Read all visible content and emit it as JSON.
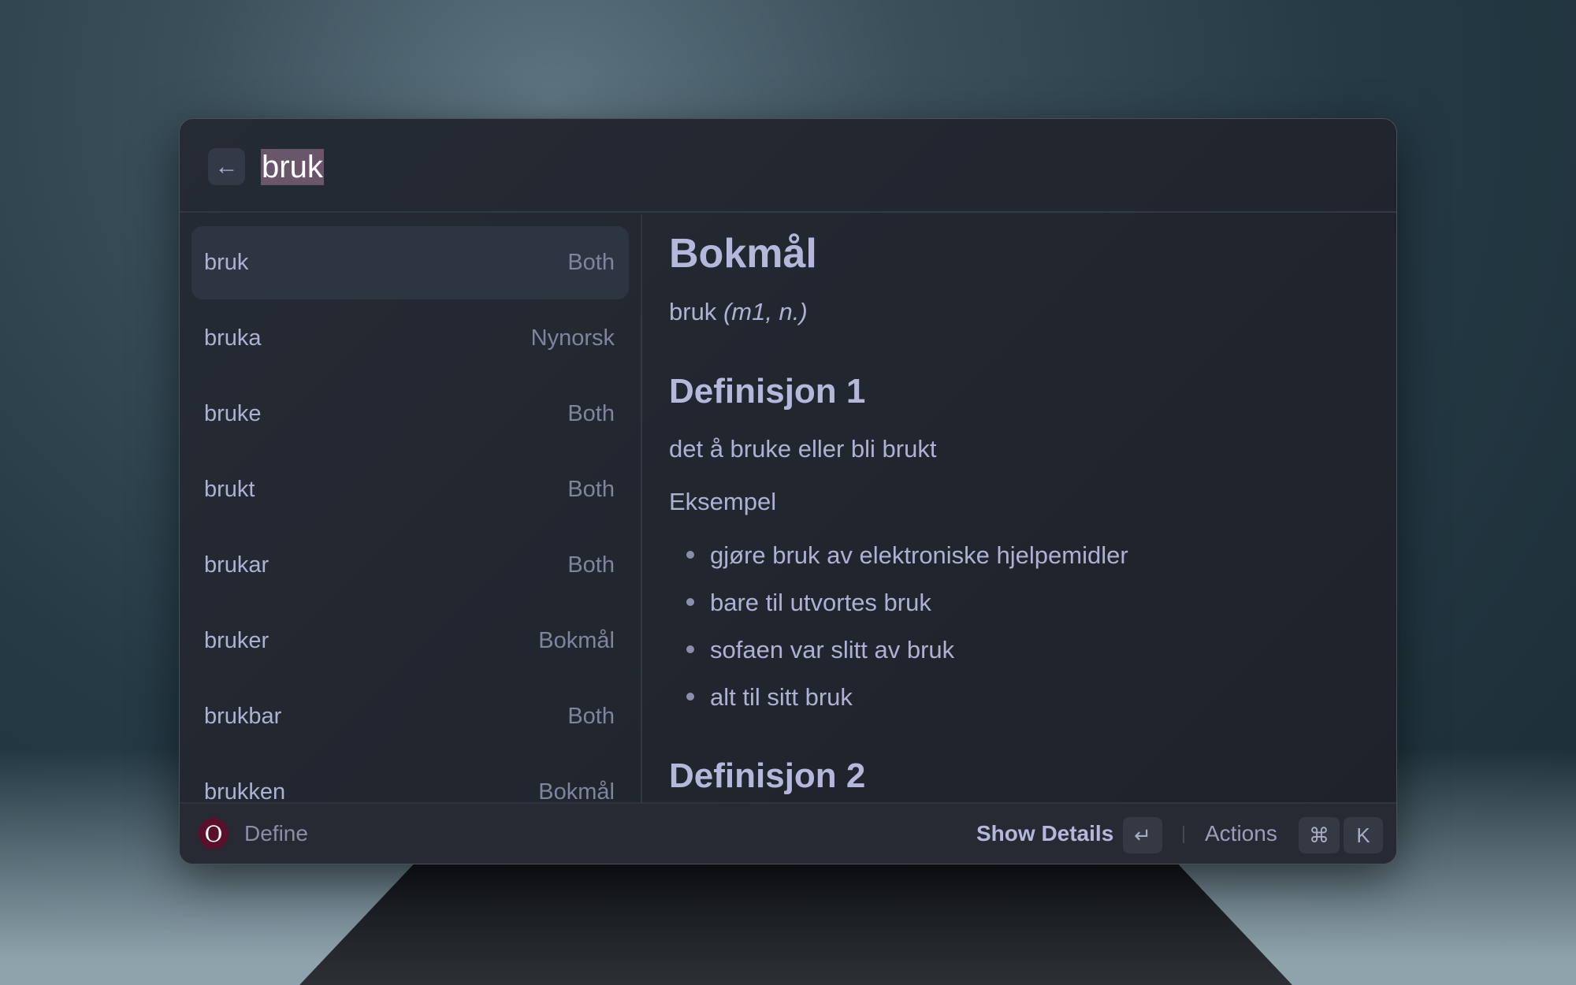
{
  "search": {
    "query": "bruk",
    "back_icon": "arrow-left-icon"
  },
  "results": [
    {
      "word": "bruk",
      "tag": "Both",
      "selected": true
    },
    {
      "word": "bruka",
      "tag": "Nynorsk"
    },
    {
      "word": "bruke",
      "tag": "Both"
    },
    {
      "word": "brukt",
      "tag": "Both"
    },
    {
      "word": "brukar",
      "tag": "Both"
    },
    {
      "word": "bruker",
      "tag": "Bokmål"
    },
    {
      "word": "brukbar",
      "tag": "Both"
    },
    {
      "word": "brukken",
      "tag": "Bokmål"
    }
  ],
  "detail": {
    "heading": "Bokmål",
    "entry_word": "bruk",
    "entry_grammar": "(m1, n.)",
    "definitions": [
      {
        "title": "Definisjon 1",
        "text": "det å bruke eller bli brukt",
        "example_label": "Eksempel",
        "examples": [
          "gjøre bruk av elektroniske hjelpemidler",
          "bare til utvortes bruk",
          "sofaen var slitt av bruk",
          "alt til sitt bruk"
        ]
      },
      {
        "title": "Definisjon 2"
      }
    ]
  },
  "footer": {
    "app_icon_letter": "O",
    "app_name": "Define",
    "primary_action": "Show Details",
    "enter_key": "↵",
    "actions_label": "Actions",
    "cmd_key": "⌘",
    "k_key": "K"
  },
  "colors": {
    "selection": "#6a566b",
    "app_icon": "#5a0f2a"
  }
}
